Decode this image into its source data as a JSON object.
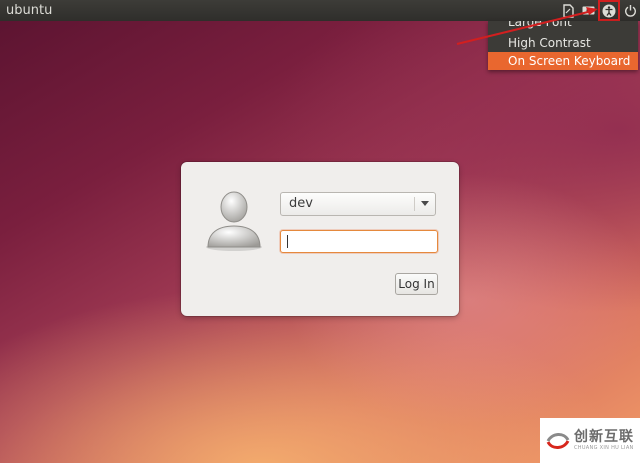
{
  "topbar": {
    "hostname": "ubuntu",
    "indicators": [
      {
        "name": "document-icon"
      },
      {
        "name": "keyboard-layout-icon"
      },
      {
        "name": "accessibility-icon"
      },
      {
        "name": "power-icon"
      }
    ]
  },
  "a11y_menu": {
    "items": [
      "Large Font",
      "High Contrast",
      "On Screen Keyboard"
    ],
    "highlighted": "On Screen Keyboard"
  },
  "login": {
    "username": "dev",
    "password_value": "",
    "login_button": "Log In"
  },
  "watermark": {
    "cn_text": "创新互联",
    "en_text": "CHUANG XIN HU LIAN"
  },
  "colors": {
    "menu_highlight": "#e9672f",
    "annotation": "#d21f1f",
    "panel": "#3c3b37"
  }
}
